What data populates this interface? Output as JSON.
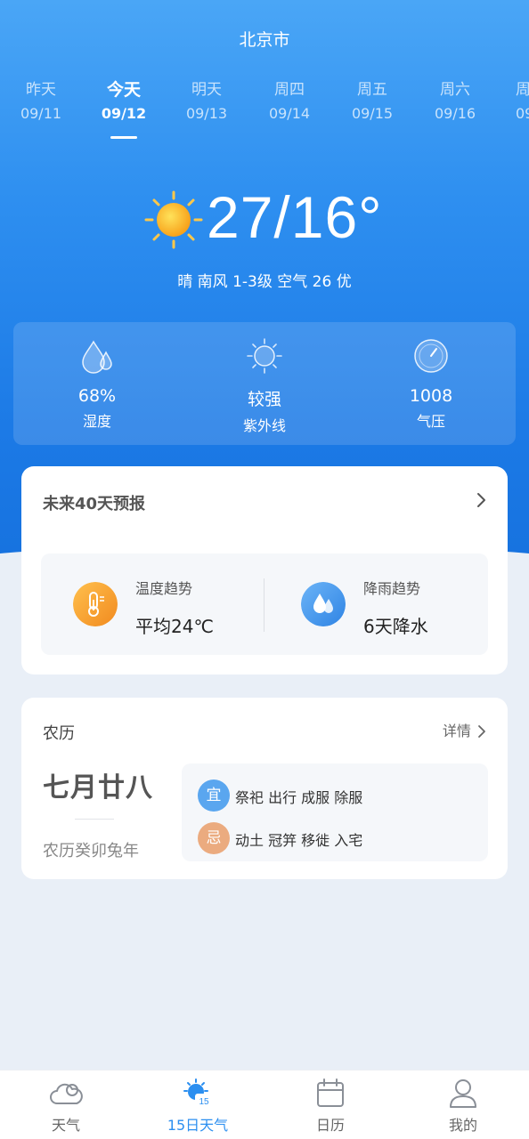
{
  "header": {
    "city": "北京市"
  },
  "days": [
    {
      "name": "昨天",
      "date": "09/11"
    },
    {
      "name": "今天",
      "date": "09/12"
    },
    {
      "name": "明天",
      "date": "09/13"
    },
    {
      "name": "周四",
      "date": "09/14"
    },
    {
      "name": "周五",
      "date": "09/15"
    },
    {
      "name": "周六",
      "date": "09/16"
    },
    {
      "name": "周",
      "date": "09"
    }
  ],
  "today": {
    "icon": "sun-icon",
    "temp": "27/16°",
    "condition": "晴 南风 1-3级 空气 26 优"
  },
  "stats": [
    {
      "icon": "humidity-icon",
      "value": "68%",
      "label": "湿度"
    },
    {
      "icon": "uv-icon",
      "value": "较强",
      "label": "紫外线"
    },
    {
      "icon": "pressure-icon",
      "value": "1008",
      "label": "气压"
    }
  ],
  "forecast40": {
    "title": "未来40天预报",
    "temp_trend": {
      "label": "温度趋势",
      "value": "平均24℃"
    },
    "rain_trend": {
      "label": "降雨趋势",
      "value": "6天降水"
    }
  },
  "lunar": {
    "title": "农历",
    "detail": "详情",
    "date": "七月廿八",
    "year": "农历癸卯兔年",
    "yi": {
      "badge": "宜",
      "items": "祭祀 出行 成服 除服"
    },
    "ji": {
      "badge": "忌",
      "items": "动土 冠笄 移徙 入宅"
    }
  },
  "tabs": [
    {
      "label": "天气",
      "icon": "cloud-icon"
    },
    {
      "label": "15日天气",
      "icon": "sun-15-icon",
      "badge": "15"
    },
    {
      "label": "日历",
      "icon": "calendar-icon"
    },
    {
      "label": "我的",
      "icon": "user-icon"
    }
  ],
  "colors": {
    "accent": "#2c8ff0",
    "hero_top": "#4aa6f6",
    "hero_bottom": "#1672df",
    "yi_badge": "#5aa6ef",
    "ji_badge": "#ebab7f"
  }
}
